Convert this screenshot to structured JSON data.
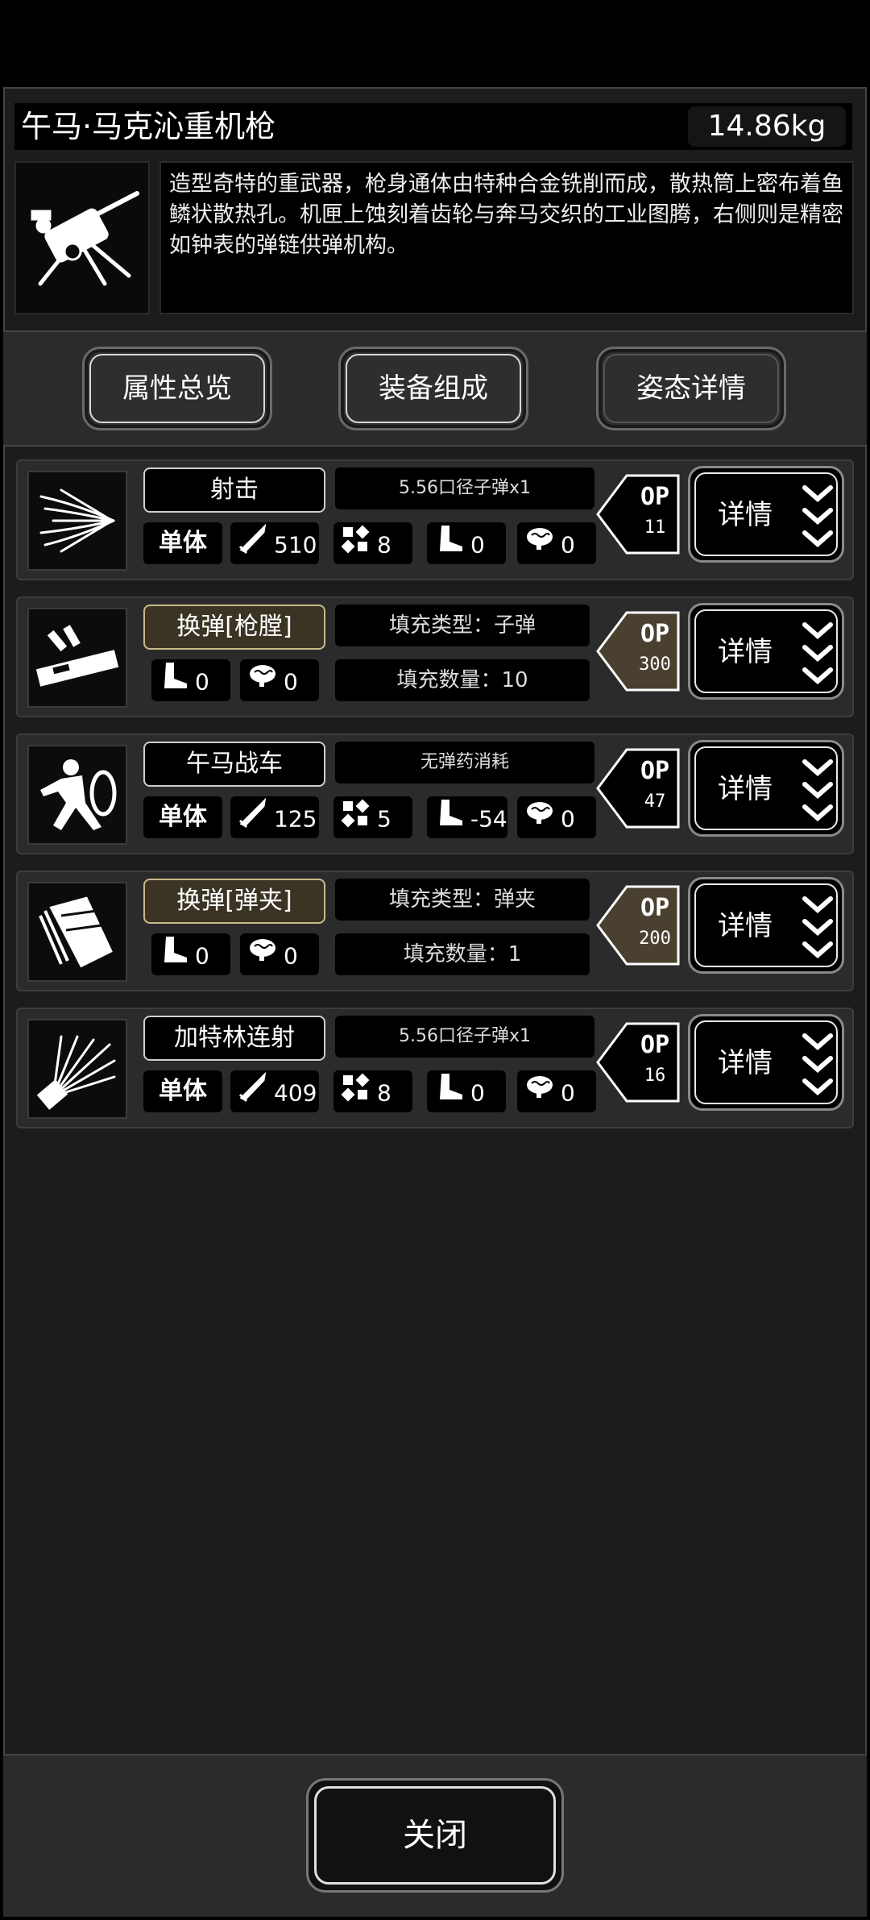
{
  "header": {
    "title": "午马·马克沁重机枪",
    "weight": "14.86kg"
  },
  "weapon": {
    "icon": "heavy-machine-gun-icon",
    "description": "造型奇特的重武器，枪身通体由特种合金铣削而成，散热筒上密布着鱼鳞状散热孔。机匣上蚀刻着齿轮与奔马交织的工业图腾，右侧则是精密如钟表的弹链供弹机构。"
  },
  "tabs": [
    {
      "label": "属性总览",
      "active": false
    },
    {
      "label": "装备组成",
      "active": false
    },
    {
      "label": "姿态详情",
      "active": true
    }
  ],
  "skills": [
    {
      "name": "射击",
      "kind": "attack",
      "info": "5.56口径子弹x1",
      "target": "单体",
      "damage": "510",
      "hit": "8",
      "move": "0",
      "stress": "0",
      "op_label": "OP",
      "op_value": "11",
      "detail_label": "详情",
      "icon": "muzzle-spray-icon"
    },
    {
      "name": "换弹[枪膛]",
      "kind": "reload",
      "info": "填充类型：子弹",
      "move": "0",
      "stress": "0",
      "fill": "填充数量：10",
      "op_label": "OP",
      "op_value": "300",
      "detail_label": "详情",
      "icon": "reload-chamber-icon"
    },
    {
      "name": "午马战车",
      "kind": "attack",
      "info": "无弹药消耗",
      "target": "单体",
      "damage": "125",
      "hit": "5",
      "move": "-54",
      "stress": "0",
      "op_label": "OP",
      "op_value": "47",
      "detail_label": "详情",
      "icon": "shield-charge-icon"
    },
    {
      "name": "换弹[弹夹]",
      "kind": "reload",
      "info": "填充类型：弹夹",
      "move": "0",
      "stress": "0",
      "fill": "填充数量：1",
      "op_label": "OP",
      "op_value": "200",
      "detail_label": "详情",
      "icon": "magazine-icon"
    },
    {
      "name": "加特林连射",
      "kind": "attack",
      "info": "5.56口径子弹x1",
      "target": "单体",
      "damage": "409",
      "hit": "8",
      "move": "0",
      "stress": "0",
      "op_label": "OP",
      "op_value": "16",
      "detail_label": "详情",
      "icon": "gatling-burst-icon"
    }
  ],
  "footer": {
    "close_label": "关闭"
  },
  "colors": {
    "panel": "#1c1c1c",
    "row": "#2b2b2b",
    "reload_chip": "#3b3424",
    "reload_op": "#4a4030"
  }
}
